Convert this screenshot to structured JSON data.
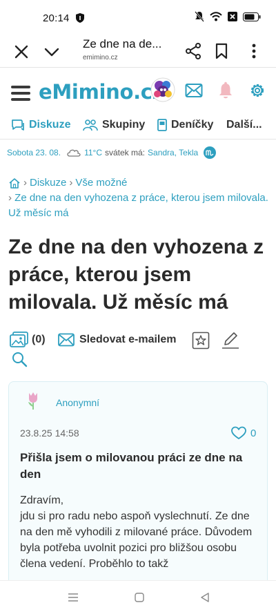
{
  "status_bar": {
    "time": "20:14"
  },
  "tab_bar": {
    "title": "Ze dne na de...",
    "url": "emimino.cz"
  },
  "header": {
    "logo": "eMimino.cz"
  },
  "nav": {
    "items": [
      "Diskuze",
      "Skupiny",
      "Deníčky",
      "Další..."
    ]
  },
  "info": {
    "date": "Sobota 23. 08.",
    "temperature": "11°C",
    "nameday_label": "svátek má:",
    "names": "Sandra, Tekla"
  },
  "breadcrumb": {
    "items": [
      "Diskuze",
      "Vše možné"
    ],
    "current": "Ze dne na den vyhozena z práce, kterou jsem milovala. Už měsíc má"
  },
  "page": {
    "title": "Ze dne na den vyhozena z práce, kterou jsem milovala. Už měsíc má"
  },
  "actions": {
    "photo_count": "(0)",
    "follow_email": "Sledovat e-mailem"
  },
  "post": {
    "author": "Anonymní",
    "date": "23.8.25 14:58",
    "likes": "0",
    "subject": "Přišla jsem o milovanou práci ze dne na den",
    "body": "Zdravím,\njdu si pro radu nebo aspoň vyslechnutí. Ze dne na den mě vyhodili z milované práce. Důvodem byla potřeba uvolnit pozici pro bližšou osobu člena vedení. Proběhlo to takž"
  },
  "colors": {
    "accent": "#2d9fbf",
    "bell": "#f2b8bf"
  }
}
